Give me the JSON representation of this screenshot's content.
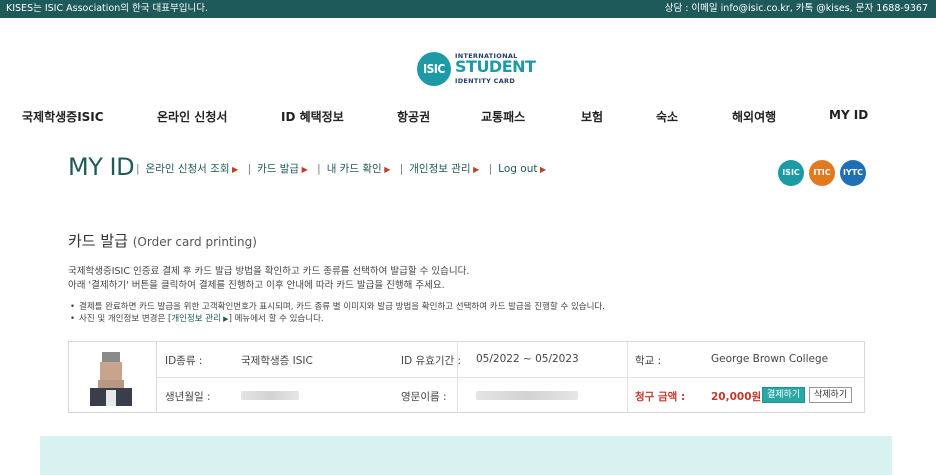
{
  "topbar": {
    "left_text": "KISES는 ISIC Association의 한국 대표부입니다.",
    "right_text": "상담 : 이메일 info@isic.co.kr, 카톡 @kises, 문자 1688-9367"
  },
  "logo": {
    "circle_text": "ISIC",
    "line1": "INTERNATIONAL",
    "line2": "STUDENT",
    "line3": "IDENTITY CARD"
  },
  "nav": {
    "items": [
      "국제학생증ISIC",
      "온라인 신청서",
      "ID 혜택정보",
      "항공권",
      "교통패스",
      "보험",
      "숙소",
      "해외여행",
      "MY ID"
    ]
  },
  "myid": {
    "title": "MY ID",
    "links": [
      "온라인 신청서 조회",
      "카드 발급",
      "내 카드 확인",
      "개인정보 관리",
      "Log out"
    ]
  },
  "badges": [
    {
      "text": "ISIC",
      "color": "#1e9aa6"
    },
    {
      "text": "ITIC",
      "color": "#e07a1f"
    },
    {
      "text": "IYTC",
      "color": "#1f6fb5"
    }
  ],
  "section": {
    "title": "카드 발급",
    "title_en": "(Order card printing)",
    "desc1": "국제학생증ISIC 인증료 결제 후 카드 발급 방법을 확인하고 카드 종류를 선택하여 발급할 수 있습니다.",
    "desc2": "아래 '결제하기' 버튼을 클릭하여 결제를 진행하고 이후 안내에 따라 카드 발급을 진행해 주세요.",
    "note1": "결제를 완료하면 카드 발급을 위한 고객확인번호가 표시되며, 카드 종류 별 이미지와 발급 방법을 확인하고 선택하여 카드 발급을 진행할 수 있습니다.",
    "note2_prefix": "사진 및 개인정보 변경은 [",
    "note2_link": "개인정보 관리",
    "note2_suffix": "] 메뉴에서 할 수 있습니다."
  },
  "card": {
    "id_type_label": "ID종류 :",
    "id_type_value": "국제학생증 ISIC",
    "validity_label": "ID 유효기간 :",
    "validity_value": "05/2022 ~ 05/2023",
    "school_label": "학교 :",
    "school_value": "George Brown College",
    "birth_label": "생년월일 :",
    "eng_name_label": "영문이름 :",
    "price_label": "청구 금액 :",
    "price_value": "20,000원",
    "pay_button": "결제하기",
    "delete_button": "삭제하기"
  },
  "colors": {
    "brand_dark": "#1f5a5b",
    "brand_teal": "#1e9aa6",
    "price_red": "#c0392b",
    "footer_band": "#d8f1f1"
  }
}
